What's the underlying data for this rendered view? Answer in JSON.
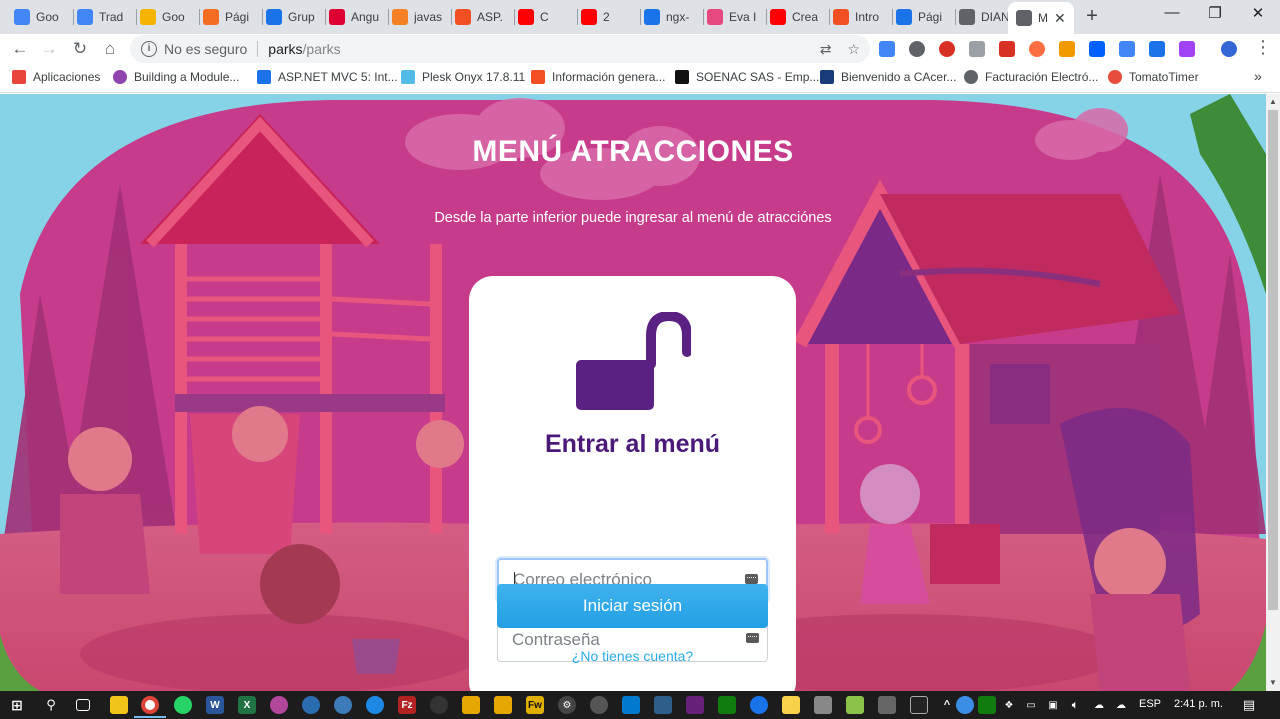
{
  "browser": {
    "tabs": [
      {
        "title": "Goo",
        "icon": "google-docs-icon",
        "color": "#4285f4"
      },
      {
        "title": "Trad",
        "icon": "google-translate-icon",
        "color": "#4285f4"
      },
      {
        "title": "Goo",
        "icon": "google-keep-icon",
        "color": "#f4b400"
      },
      {
        "title": "Pági",
        "icon": "d-icon",
        "color": "#f36c21"
      },
      {
        "title": "Grup",
        "icon": "tick-icon",
        "color": "#1a73e8"
      },
      {
        "title": "Angu",
        "icon": "angular-icon",
        "color": "#dd0031"
      },
      {
        "title": "javas",
        "icon": "stack-icon",
        "color": "#f48024"
      },
      {
        "title": "ASP.",
        "icon": "microsoft-icon",
        "color": "#f25022"
      },
      {
        "title": "C",
        "icon": "youtube-icon",
        "color": "#ff0000"
      },
      {
        "title": "2",
        "icon": "youtube-icon",
        "color": "#ff0000"
      },
      {
        "title": "ngx-",
        "icon": "loading-icon",
        "color": "#1a73e8"
      },
      {
        "title": "Eva I",
        "icon": "heart-icon",
        "color": "#e64980"
      },
      {
        "title": "Crea",
        "icon": "youtube-icon",
        "color": "#ff0000"
      },
      {
        "title": "Intro",
        "icon": "microsoft-icon",
        "color": "#f25022"
      },
      {
        "title": "Pági",
        "icon": "loading-icon",
        "color": "#1a73e8"
      },
      {
        "title": "DIAN",
        "icon": "globe-icon",
        "color": "#5f6368"
      },
      {
        "title": "M",
        "icon": "globe-icon",
        "color": "#5f6368"
      }
    ],
    "new_tab": "+",
    "window_controls": {
      "minimize": "—",
      "maximize": "❐",
      "close": "✕"
    },
    "address": {
      "security_label": "No es seguro",
      "host": "parks",
      "path": "/parks"
    },
    "bookmarks": [
      {
        "label": "Aplicaciones",
        "icon": "apps-grid-icon",
        "color": "#e8453c"
      },
      {
        "label": "Building a Module...",
        "icon": "circle-icon",
        "color": "#8e44ad"
      },
      {
        "label": "ASP.NET MVC 5: Int...",
        "icon": "tick-icon",
        "color": "#1a73e8"
      },
      {
        "label": "Plesk Onyx 17.8.11",
        "icon": "plesk-icon",
        "color": "#53bce6"
      },
      {
        "label": "Información genera...",
        "icon": "microsoft-icon",
        "color": "#f25022"
      },
      {
        "label": "SOENAC SAS - Emp...",
        "icon": "soenac-icon",
        "color": "#111111"
      },
      {
        "label": "Bienvenido a CAcer...",
        "icon": "ca-icon",
        "color": "#1a3c7a"
      },
      {
        "label": "Facturación Electró...",
        "icon": "globe-icon",
        "color": "#5f6368"
      },
      {
        "label": "TomatoTimer",
        "icon": "tomato-icon",
        "color": "#e74c3c"
      }
    ],
    "bookmarks_more": "»"
  },
  "page": {
    "title": "MENÚ ATRACCIONES",
    "subtitle": "Desde la parte inferior puede ingresar al menú de atracciónes",
    "login": {
      "heading": "Entrar al menú",
      "email_placeholder": "Correo electrónico",
      "password_placeholder": "Contraseña",
      "submit_label": "Iniciar sesión",
      "signup_link": "¿No tienes cuenta?"
    },
    "colors": {
      "overlay": "#c2378a",
      "heading": "#4b1a78",
      "lock": "#5b2182",
      "button": "#2aa6e8",
      "link": "#2bace6"
    }
  },
  "taskbar": {
    "language": "ESP",
    "time": "2:41 p. m."
  }
}
